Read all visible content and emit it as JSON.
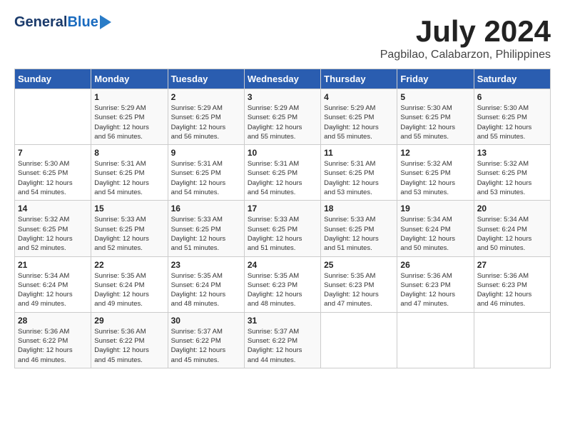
{
  "header": {
    "logo_general": "General",
    "logo_blue": "Blue",
    "month_year": "July 2024",
    "location": "Pagbilao, Calabarzon, Philippines"
  },
  "columns": [
    "Sunday",
    "Monday",
    "Tuesday",
    "Wednesday",
    "Thursday",
    "Friday",
    "Saturday"
  ],
  "weeks": [
    [
      {
        "num": "",
        "info": ""
      },
      {
        "num": "1",
        "info": "Sunrise: 5:29 AM\nSunset: 6:25 PM\nDaylight: 12 hours\nand 56 minutes."
      },
      {
        "num": "2",
        "info": "Sunrise: 5:29 AM\nSunset: 6:25 PM\nDaylight: 12 hours\nand 56 minutes."
      },
      {
        "num": "3",
        "info": "Sunrise: 5:29 AM\nSunset: 6:25 PM\nDaylight: 12 hours\nand 55 minutes."
      },
      {
        "num": "4",
        "info": "Sunrise: 5:29 AM\nSunset: 6:25 PM\nDaylight: 12 hours\nand 55 minutes."
      },
      {
        "num": "5",
        "info": "Sunrise: 5:30 AM\nSunset: 6:25 PM\nDaylight: 12 hours\nand 55 minutes."
      },
      {
        "num": "6",
        "info": "Sunrise: 5:30 AM\nSunset: 6:25 PM\nDaylight: 12 hours\nand 55 minutes."
      }
    ],
    [
      {
        "num": "7",
        "info": "Sunrise: 5:30 AM\nSunset: 6:25 PM\nDaylight: 12 hours\nand 54 minutes."
      },
      {
        "num": "8",
        "info": "Sunrise: 5:31 AM\nSunset: 6:25 PM\nDaylight: 12 hours\nand 54 minutes."
      },
      {
        "num": "9",
        "info": "Sunrise: 5:31 AM\nSunset: 6:25 PM\nDaylight: 12 hours\nand 54 minutes."
      },
      {
        "num": "10",
        "info": "Sunrise: 5:31 AM\nSunset: 6:25 PM\nDaylight: 12 hours\nand 54 minutes."
      },
      {
        "num": "11",
        "info": "Sunrise: 5:31 AM\nSunset: 6:25 PM\nDaylight: 12 hours\nand 53 minutes."
      },
      {
        "num": "12",
        "info": "Sunrise: 5:32 AM\nSunset: 6:25 PM\nDaylight: 12 hours\nand 53 minutes."
      },
      {
        "num": "13",
        "info": "Sunrise: 5:32 AM\nSunset: 6:25 PM\nDaylight: 12 hours\nand 53 minutes."
      }
    ],
    [
      {
        "num": "14",
        "info": "Sunrise: 5:32 AM\nSunset: 6:25 PM\nDaylight: 12 hours\nand 52 minutes."
      },
      {
        "num": "15",
        "info": "Sunrise: 5:33 AM\nSunset: 6:25 PM\nDaylight: 12 hours\nand 52 minutes."
      },
      {
        "num": "16",
        "info": "Sunrise: 5:33 AM\nSunset: 6:25 PM\nDaylight: 12 hours\nand 51 minutes."
      },
      {
        "num": "17",
        "info": "Sunrise: 5:33 AM\nSunset: 6:25 PM\nDaylight: 12 hours\nand 51 minutes."
      },
      {
        "num": "18",
        "info": "Sunrise: 5:33 AM\nSunset: 6:25 PM\nDaylight: 12 hours\nand 51 minutes."
      },
      {
        "num": "19",
        "info": "Sunrise: 5:34 AM\nSunset: 6:24 PM\nDaylight: 12 hours\nand 50 minutes."
      },
      {
        "num": "20",
        "info": "Sunrise: 5:34 AM\nSunset: 6:24 PM\nDaylight: 12 hours\nand 50 minutes."
      }
    ],
    [
      {
        "num": "21",
        "info": "Sunrise: 5:34 AM\nSunset: 6:24 PM\nDaylight: 12 hours\nand 49 minutes."
      },
      {
        "num": "22",
        "info": "Sunrise: 5:35 AM\nSunset: 6:24 PM\nDaylight: 12 hours\nand 49 minutes."
      },
      {
        "num": "23",
        "info": "Sunrise: 5:35 AM\nSunset: 6:24 PM\nDaylight: 12 hours\nand 48 minutes."
      },
      {
        "num": "24",
        "info": "Sunrise: 5:35 AM\nSunset: 6:23 PM\nDaylight: 12 hours\nand 48 minutes."
      },
      {
        "num": "25",
        "info": "Sunrise: 5:35 AM\nSunset: 6:23 PM\nDaylight: 12 hours\nand 47 minutes."
      },
      {
        "num": "26",
        "info": "Sunrise: 5:36 AM\nSunset: 6:23 PM\nDaylight: 12 hours\nand 47 minutes."
      },
      {
        "num": "27",
        "info": "Sunrise: 5:36 AM\nSunset: 6:23 PM\nDaylight: 12 hours\nand 46 minutes."
      }
    ],
    [
      {
        "num": "28",
        "info": "Sunrise: 5:36 AM\nSunset: 6:22 PM\nDaylight: 12 hours\nand 46 minutes."
      },
      {
        "num": "29",
        "info": "Sunrise: 5:36 AM\nSunset: 6:22 PM\nDaylight: 12 hours\nand 45 minutes."
      },
      {
        "num": "30",
        "info": "Sunrise: 5:37 AM\nSunset: 6:22 PM\nDaylight: 12 hours\nand 45 minutes."
      },
      {
        "num": "31",
        "info": "Sunrise: 5:37 AM\nSunset: 6:22 PM\nDaylight: 12 hours\nand 44 minutes."
      },
      {
        "num": "",
        "info": ""
      },
      {
        "num": "",
        "info": ""
      },
      {
        "num": "",
        "info": ""
      }
    ]
  ]
}
